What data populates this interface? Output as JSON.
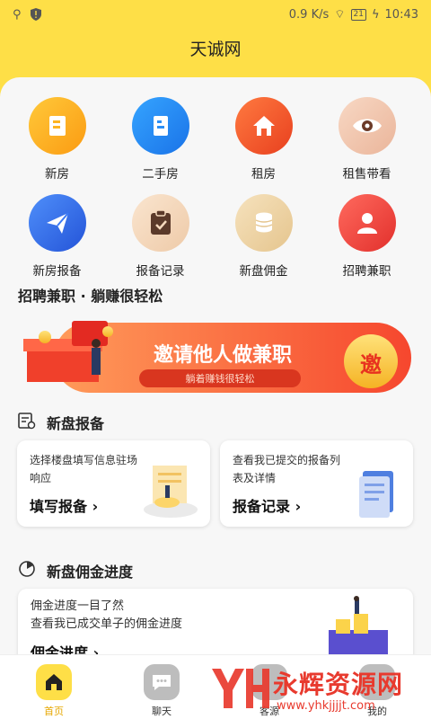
{
  "status_bar": {
    "network": "0.9 K/s",
    "battery": "21",
    "time": "10:43"
  },
  "header": {
    "title": "天诚网"
  },
  "grid": [
    {
      "label": "新房",
      "icon": "building-icon",
      "color": "#fdb420"
    },
    {
      "label": "二手房",
      "icon": "building-b-icon",
      "color": "#2b8ff6"
    },
    {
      "label": "租房",
      "icon": "home-icon",
      "color": "#f35a2f"
    },
    {
      "label": "租售带看",
      "icon": "eye-icon",
      "color": "#f2c7b0"
    },
    {
      "label": "新房报备",
      "icon": "send-icon",
      "color": "#3b7af5"
    },
    {
      "label": "报备记录",
      "icon": "clipboard-icon",
      "color": "#f5d9bd"
    },
    {
      "label": "新盘佣金",
      "icon": "coins-icon",
      "color": "#f1d9ab"
    },
    {
      "label": "招聘兼职",
      "icon": "user-icon",
      "color": "#f0453f"
    }
  ],
  "recruit": {
    "title": "招聘兼职 · 躺赚很轻松",
    "banner_main": "邀请他人做兼职",
    "banner_sub": "躺着赚钱很轻松",
    "banner_badge": "邀"
  },
  "report_section": {
    "title": "新盘报备",
    "cards": [
      {
        "desc": "选择楼盘填写信息驻场响应",
        "action": "填写报备"
      },
      {
        "desc": "查看我已提交的报备列表及详情",
        "action": "报备记录"
      }
    ]
  },
  "commission_section": {
    "title": "新盘佣金进度",
    "line1": "佣金进度一目了然",
    "line2": "查看我已成交单子的佣金进度",
    "action": "佣金进度"
  },
  "tabbar": [
    {
      "label": "首页",
      "active": true
    },
    {
      "label": "聊天",
      "active": false
    },
    {
      "label": "客源",
      "active": false
    },
    {
      "label": "我的",
      "active": false
    }
  ],
  "watermark": {
    "text": "永辉资源网",
    "url": "www.yhkjjjjt.com"
  }
}
